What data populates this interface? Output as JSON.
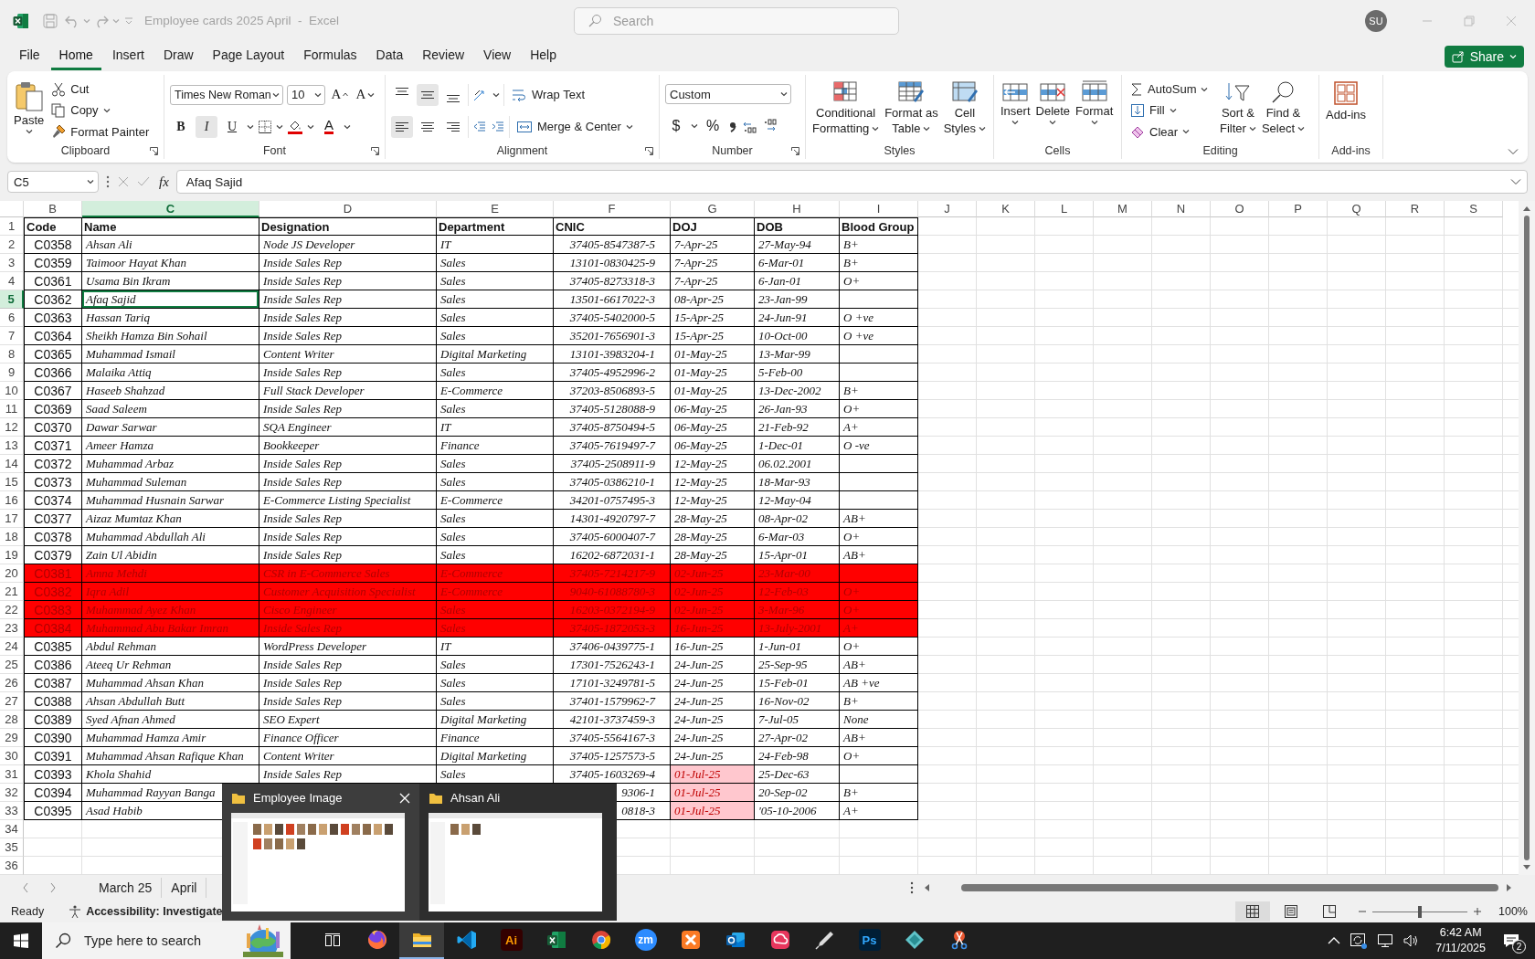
{
  "titlebar": {
    "title": "Employee cards 2025 April  -  Excel",
    "search_placeholder": "Search",
    "avatar": "SU"
  },
  "menu": [
    {
      "label": "File",
      "selected": false
    },
    {
      "label": "Home",
      "selected": true
    },
    {
      "label": "Insert",
      "selected": false
    },
    {
      "label": "Draw",
      "selected": false
    },
    {
      "label": "Page Layout",
      "selected": false
    },
    {
      "label": "Formulas",
      "selected": false
    },
    {
      "label": "Data",
      "selected": false
    },
    {
      "label": "Review",
      "selected": false
    },
    {
      "label": "View",
      "selected": false
    },
    {
      "label": "Help",
      "selected": false
    }
  ],
  "share": "Share",
  "ribbon": {
    "clipboard": {
      "label": "Clipboard",
      "paste": "Paste",
      "cut": "Cut",
      "copy": "Copy",
      "format_painter": "Format Painter"
    },
    "font": {
      "label": "Font",
      "font_name": "Times New Roman",
      "font_size": "10",
      "grow": "A",
      "shrink": "A",
      "font_color": "A",
      "styles": [
        {
          "label": "B",
          "selected": false
        },
        {
          "label": "I",
          "selected": true
        },
        {
          "label": "U",
          "selected": false
        }
      ]
    },
    "alignment": {
      "label": "Alignment",
      "vertical": [
        {
          "selected": false
        },
        {
          "selected": true
        },
        {
          "selected": false
        }
      ],
      "horizontal": [
        {
          "selected": true
        },
        {
          "selected": false
        },
        {
          "selected": false
        }
      ],
      "wrap_text": "Wrap Text",
      "merge": "Merge & Center"
    },
    "number": {
      "label": "Number",
      "format": "Custom",
      "currency": "$",
      "percent": "%"
    },
    "styles": {
      "label": "Styles",
      "buttons": [
        {
          "kind": "conditional",
          "lines": [
            "Conditional",
            "Formatting"
          ]
        },
        {
          "kind": "table",
          "lines": [
            "Format as",
            "Table"
          ]
        },
        {
          "kind": "cell",
          "lines": [
            "Cell",
            "Styles"
          ]
        }
      ]
    },
    "cells": {
      "label": "Cells",
      "buttons": [
        {
          "kind": "insert",
          "label": "Insert"
        },
        {
          "kind": "delete",
          "label": "Delete"
        },
        {
          "kind": "format",
          "label": "Format"
        }
      ]
    },
    "editing": {
      "label": "Editing",
      "autosum": "AutoSum",
      "fill": "Fill",
      "clear": "Clear",
      "sort": [
        "Sort &",
        "Filter"
      ],
      "find": [
        "Find &",
        "Select"
      ]
    },
    "addins": {
      "label": "Add-ins",
      "button": "Add-ins"
    }
  },
  "formula_bar": {
    "name_box": "C5",
    "fx": "fx",
    "value": "Afaq Sajid"
  },
  "columns": [
    {
      "label": "B",
      "selected": false
    },
    {
      "label": "C",
      "selected": true
    },
    {
      "label": "D",
      "selected": false
    },
    {
      "label": "E",
      "selected": false
    },
    {
      "label": "F",
      "selected": false
    },
    {
      "label": "G",
      "selected": false
    },
    {
      "label": "H",
      "selected": false
    },
    {
      "label": "I",
      "selected": false
    },
    {
      "label": "J",
      "selected": false
    },
    {
      "label": "K",
      "selected": false
    },
    {
      "label": "L",
      "selected": false
    },
    {
      "label": "M",
      "selected": false
    },
    {
      "label": "N",
      "selected": false
    },
    {
      "label": "O",
      "selected": false
    },
    {
      "label": "P",
      "selected": false
    },
    {
      "label": "Q",
      "selected": false
    },
    {
      "label": "R",
      "selected": false
    },
    {
      "label": "S",
      "selected": false
    }
  ],
  "rows": [
    {
      "number": "1",
      "kind": "header",
      "selected": false,
      "flagged": false,
      "doj_overdue": false,
      "code": "Code",
      "name": "Name",
      "designation": "Designation",
      "department": "Department",
      "cnic": "CNIC",
      "doj": "DOJ",
      "dob": "DOB",
      "blood_group": "Blood Group"
    },
    {
      "number": "2",
      "kind": "data",
      "selected": false,
      "flagged": false,
      "doj_overdue": false,
      "code": "C0358",
      "name": "Ahsan Ali",
      "designation": "Node JS Developer",
      "department": "IT",
      "cnic": "37405-8547387-5",
      "doj": "7-Apr-25",
      "dob": "27-May-94",
      "blood_group": "B+"
    },
    {
      "number": "3",
      "kind": "data",
      "selected": false,
      "flagged": false,
      "doj_overdue": false,
      "code": "C0359",
      "name": "Taimoor Hayat Khan",
      "designation": "Inside Sales Rep",
      "department": "Sales",
      "cnic": "13101-0830425-9",
      "doj": "7-Apr-25",
      "dob": "6-Mar-01",
      "blood_group": "B+"
    },
    {
      "number": "4",
      "kind": "data",
      "selected": false,
      "flagged": false,
      "doj_overdue": false,
      "code": "C0361",
      "name": "Usama Bin Ikram",
      "designation": "Inside Sales Rep",
      "department": "Sales",
      "cnic": "37405-8273318-3",
      "doj": "7-Apr-25",
      "dob": "6-Jan-01",
      "blood_group": "O+"
    },
    {
      "number": "5",
      "kind": "data",
      "selected": true,
      "flagged": false,
      "doj_overdue": false,
      "code": "C0362",
      "name": "Afaq Sajid",
      "designation": "Inside Sales Rep",
      "department": "Sales",
      "cnic": "13501-6617022-3",
      "doj": "08-Apr-25",
      "dob": "23-Jan-99"
    },
    {
      "number": "6",
      "kind": "data",
      "selected": false,
      "flagged": false,
      "doj_overdue": false,
      "code": "C0363",
      "name": "Hassan Tariq",
      "designation": "Inside Sales Rep",
      "department": "Sales",
      "cnic": "37405-5402000-5",
      "doj": "15-Apr-25",
      "dob": "24-Jun-91",
      "blood_group": "O +ve"
    },
    {
      "number": "7",
      "kind": "data",
      "selected": false,
      "flagged": false,
      "doj_overdue": false,
      "code": "C0364",
      "name": "Sheikh Hamza Bin Sohail",
      "designation": "Inside Sales Rep",
      "department": "Sales",
      "cnic": "35201-7656901-3",
      "doj": "15-Apr-25",
      "dob": "10-Oct-00",
      "blood_group": "O +ve"
    },
    {
      "number": "8",
      "kind": "data",
      "selected": false,
      "flagged": false,
      "doj_overdue": false,
      "code": "C0365",
      "name": "Muhammad Ismail",
      "designation": "Content Writer",
      "department": "Digital Marketing",
      "cnic": "13101-3983204-1",
      "doj": "01-May-25",
      "dob": "13-Mar-99"
    },
    {
      "number": "9",
      "kind": "data",
      "selected": false,
      "flagged": false,
      "doj_overdue": false,
      "code": "C0366",
      "name": "Malaika Attiq",
      "designation": "Inside Sales Rep",
      "department": "Sales",
      "cnic": "37405-4952996-2",
      "doj": "01-May-25",
      "dob": "5-Feb-00"
    },
    {
      "number": "10",
      "kind": "data",
      "selected": false,
      "flagged": false,
      "doj_overdue": false,
      "code": "C0367",
      "name": "Haseeb Shahzad",
      "designation": "Full Stack Developer",
      "department": "E-Commerce",
      "cnic": "37203-8506893-5",
      "doj": "01-May-25",
      "dob": "13-Dec-2002",
      "blood_group": "B+"
    },
    {
      "number": "11",
      "kind": "data",
      "selected": false,
      "flagged": false,
      "doj_overdue": false,
      "code": "C0369",
      "name": "Saad Saleem",
      "designation": "Inside Sales Rep",
      "department": "Sales",
      "cnic": "37405-5128088-9",
      "doj": "06-May-25",
      "dob": "26-Jan-93",
      "blood_group": "O+"
    },
    {
      "number": "12",
      "kind": "data",
      "selected": false,
      "flagged": false,
      "doj_overdue": false,
      "code": "C0370",
      "name": "Dawar Sarwar",
      "designation": "SQA Engineer",
      "department": "IT",
      "cnic": "37405-8750494-5",
      "doj": "06-May-25",
      "dob": "21-Feb-92",
      "blood_group": "A+"
    },
    {
      "number": "13",
      "kind": "data",
      "selected": false,
      "flagged": false,
      "doj_overdue": false,
      "code": "C0371",
      "name": "Ameer Hamza",
      "designation": "Bookkeeper",
      "department": "Finance",
      "cnic": "37405-7619497-7",
      "doj": "06-May-25",
      "dob": "1-Dec-01",
      "blood_group": "O -ve"
    },
    {
      "number": "14",
      "kind": "data",
      "selected": false,
      "flagged": false,
      "doj_overdue": false,
      "code": "C0372",
      "name": "Muhammad Arbaz",
      "designation": "Inside Sales Rep",
      "department": "Sales",
      "cnic": "37405-2508911-9",
      "doj": "12-May-25",
      "dob": "06.02.2001"
    },
    {
      "number": "15",
      "kind": "data",
      "selected": false,
      "flagged": false,
      "doj_overdue": false,
      "code": "C0373",
      "name": "Muhammad Suleman",
      "designation": "Inside Sales Rep",
      "department": "Sales",
      "cnic": "37405-0386210-1",
      "doj": "12-May-25",
      "dob": "18-Mar-93"
    },
    {
      "number": "16",
      "kind": "data",
      "selected": false,
      "flagged": false,
      "doj_overdue": false,
      "code": "C0374",
      "name": "Muhammad Husnain Sarwar",
      "designation": "E-Commerce Listing Specialist",
      "department": "E-Commerce",
      "cnic": "34201-0757495-3",
      "doj": "12-May-25",
      "dob": "12-May-04"
    },
    {
      "number": "17",
      "kind": "data",
      "selected": false,
      "flagged": false,
      "doj_overdue": false,
      "code": "C0377",
      "name": "Aizaz Mumtaz Khan",
      "designation": "Inside Sales Rep",
      "department": "Sales",
      "cnic": "14301-4920797-7",
      "doj": "28-May-25",
      "dob": "08-Apr-02",
      "blood_group": "AB+"
    },
    {
      "number": "18",
      "kind": "data",
      "selected": false,
      "flagged": false,
      "doj_overdue": false,
      "code": "C0378",
      "name": "Muhammad Abdullah Ali",
      "designation": "Inside Sales Rep",
      "department": "Sales",
      "cnic": "37405-6000407-7",
      "doj": "28-May-25",
      "dob": "6-Mar-03",
      "blood_group": "O+"
    },
    {
      "number": "19",
      "kind": "data",
      "selected": false,
      "flagged": false,
      "doj_overdue": false,
      "code": "C0379",
      "name": "Zain Ul Abidin",
      "designation": "Inside Sales Rep",
      "department": "Sales",
      "cnic": "16202-6872031-1",
      "doj": "28-May-25",
      "dob": "15-Apr-01",
      "blood_group": "AB+"
    },
    {
      "number": "20",
      "kind": "data",
      "selected": false,
      "flagged": true,
      "doj_overdue": false,
      "code": "C0381",
      "name": "Amna Mehdi",
      "designation": "CSR in E-Commerce Sales",
      "department": "E-Commerce",
      "cnic": "37405-7214217-9",
      "doj": "02-Jun-25",
      "dob": "23-Mar-00"
    },
    {
      "number": "21",
      "kind": "data",
      "selected": false,
      "flagged": true,
      "doj_overdue": false,
      "code": "C0382",
      "name": "Iqra Adil",
      "designation": "Customer Acquisition Specialist",
      "department": "E-Commerce",
      "cnic": "9040-61088780-3",
      "doj": "02-Jun-25",
      "dob": "12-Feb-03",
      "blood_group": "O+"
    },
    {
      "number": "22",
      "kind": "data",
      "selected": false,
      "flagged": true,
      "doj_overdue": false,
      "code": "C0383",
      "name": "Muhammad Ayez Khan",
      "designation": "Cisco Engineer",
      "department": "Sales",
      "cnic": "16203-0372194-9",
      "doj": "02-Jun-25",
      "dob": "3-Mar-96",
      "blood_group": "O+"
    },
    {
      "number": "23",
      "kind": "data",
      "selected": false,
      "flagged": true,
      "doj_overdue": false,
      "code": "C0384",
      "name": "Muhammad Abu Bakar Imran",
      "designation": "Inside Sales Rep",
      "department": "Sales",
      "cnic": "37405-1872053-3",
      "doj": "16-Jun-25",
      "dob": "13-July-2001",
      "blood_group": "A+"
    },
    {
      "number": "24",
      "kind": "data",
      "selected": false,
      "flagged": false,
      "doj_overdue": false,
      "code": "C0385",
      "name": "Abdul Rehman",
      "designation": "WordPress Developer",
      "department": "IT",
      "cnic": "37406-0439775-1",
      "doj": "16-Jun-25",
      "dob": "1-Jun-01",
      "blood_group": "O+"
    },
    {
      "number": "25",
      "kind": "data",
      "selected": false,
      "flagged": false,
      "doj_overdue": false,
      "code": "C0386",
      "name": "Ateeq Ur Rehman",
      "designation": "Inside Sales Rep",
      "department": "Sales",
      "cnic": "17301-7526243-1",
      "doj": "24-Jun-25",
      "dob": "25-Sep-95",
      "blood_group": "AB+"
    },
    {
      "number": "26",
      "kind": "data",
      "selected": false,
      "flagged": false,
      "doj_overdue": false,
      "code": "C0387",
      "name": "Muhammad Ahsan Khan",
      "designation": "Inside Sales Rep",
      "department": "Sales",
      "cnic": "17101-3249781-5",
      "doj": "24-Jun-25",
      "dob": "15-Feb-01",
      "blood_group": "AB +ve"
    },
    {
      "number": "27",
      "kind": "data",
      "selected": false,
      "flagged": false,
      "doj_overdue": false,
      "code": "C0388",
      "name": "Ahsan Abdullah Butt",
      "designation": "Inside Sales Rep",
      "department": "Sales",
      "cnic": "37401-1579962-7",
      "doj": "24-Jun-25",
      "dob": "16-Nov-02",
      "blood_group": "B+"
    },
    {
      "number": "28",
      "kind": "data",
      "selected": false,
      "flagged": false,
      "doj_overdue": false,
      "code": "C0389",
      "name": "Syed Afnan Ahmed",
      "designation": "SEO Expert",
      "department": "Digital Marketing",
      "cnic": "42101-3737459-3",
      "doj": "24-Jun-25",
      "dob": "7-Jul-05",
      "blood_group": "None"
    },
    {
      "number": "29",
      "kind": "data",
      "selected": false,
      "flagged": false,
      "doj_overdue": false,
      "code": "C0390",
      "name": "Muhammad Hamza Amir",
      "designation": "Finance Officer",
      "department": "Finance",
      "cnic": "37405-5564167-3",
      "doj": "24-Jun-25",
      "dob": "27-Apr-02",
      "blood_group": "AB+"
    },
    {
      "number": "30",
      "kind": "data",
      "selected": false,
      "flagged": false,
      "doj_overdue": false,
      "code": "C0391",
      "name": "Muhammad Ahsan Rafique Khan",
      "designation": "Content Writer",
      "department": "Digital Marketing",
      "cnic": "37405-1257573-5",
      "doj": "24-Jun-25",
      "dob": "24-Feb-98",
      "blood_group": "O+"
    },
    {
      "number": "31",
      "kind": "data",
      "selected": false,
      "flagged": false,
      "doj_overdue": true,
      "code": "C0393",
      "name": "Khola Shahid",
      "designation": "Inside Sales Rep",
      "department": "Sales",
      "cnic": "37405-1603269-4",
      "doj": "01-Jul-25",
      "dob": "25-Dec-63"
    },
    {
      "number": "32",
      "kind": "data",
      "selected": false,
      "flagged": false,
      "doj_overdue": true,
      "code": "C0394",
      "name": "Muhammad Rayyan Banga",
      "cnic": "9306-1",
      "doj": "01-Jul-25",
      "dob": "20-Sep-02",
      "blood_group": "B+"
    },
    {
      "number": "33",
      "kind": "data",
      "selected": false,
      "flagged": false,
      "doj_overdue": true,
      "code": "C0395",
      "name": "Asad Habib",
      "cnic": "0818-3",
      "doj": "01-Jul-25",
      "dob": "'05-10-2006",
      "blood_group": "A+"
    },
    {
      "number": "34",
      "kind": "empty",
      "selected": false
    },
    {
      "number": "35",
      "kind": "empty",
      "selected": false
    },
    {
      "number": "36",
      "kind": "empty",
      "selected": false
    }
  ],
  "sheet_tabs": [
    {
      "label": "March 25",
      "selected": false
    },
    {
      "label": "April",
      "selected": false
    }
  ],
  "status_bar": {
    "ready": "Ready",
    "accessibility": "Accessibility: Investigate",
    "views": [
      {
        "kind": "normal",
        "selected": true
      },
      {
        "kind": "page_layout",
        "selected": false
      },
      {
        "kind": "page_break",
        "selected": false
      }
    ],
    "zoom": {
      "level": 0.5,
      "reading": "100%"
    }
  },
  "window_previews": [
    {
      "title": "Employee Image",
      "closable": true
    },
    {
      "title": "Ahsan Ali",
      "closable": false
    }
  ],
  "taskbar": {
    "search_placeholder": "Type here to search",
    "apps": [
      {
        "kind": "firefox",
        "active": false
      },
      {
        "kind": "explorer",
        "active": true
      },
      {
        "kind": "vscode",
        "active": false
      },
      {
        "kind": "tile",
        "label": "Ai",
        "active": false
      },
      {
        "kind": "excel",
        "active": false
      },
      {
        "kind": "chrome",
        "active": false
      },
      {
        "kind": "round",
        "label": "zm",
        "active": false
      },
      {
        "kind": "xampp",
        "active": false
      },
      {
        "kind": "outlook",
        "active": false
      },
      {
        "kind": "cloud",
        "active": false
      },
      {
        "kind": "pen",
        "active": false
      },
      {
        "kind": "tile2",
        "label": "Ps",
        "active": false
      },
      {
        "kind": "diamond",
        "active": false
      },
      {
        "kind": "snip",
        "active": false
      }
    ],
    "time": "6:42 AM",
    "date": "7/11/2025",
    "notifications": "2"
  }
}
